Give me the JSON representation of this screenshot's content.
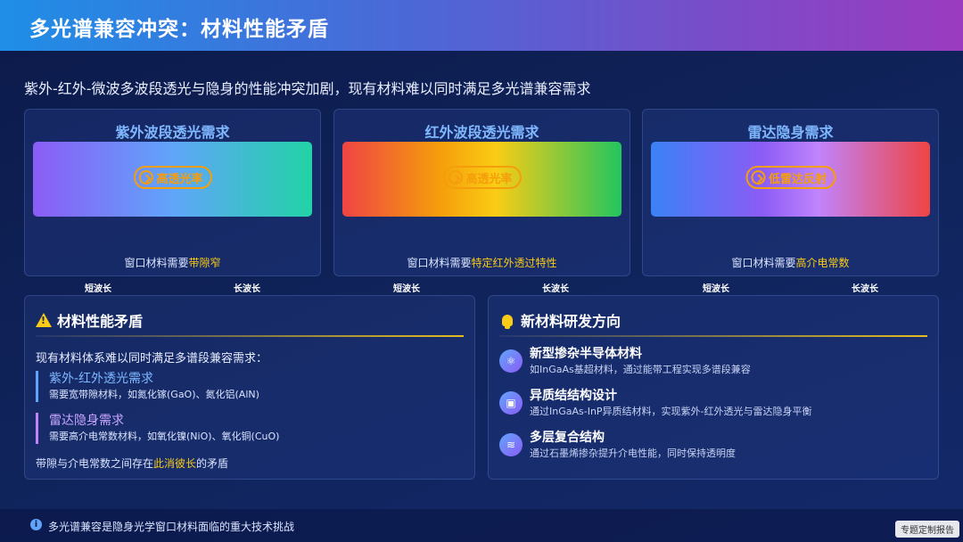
{
  "header": {
    "title": "多光谱兼容冲突：材料性能矛盾"
  },
  "subtitle": "紫外-红外-微波多波段透光与隐身的性能冲突加剧，现有材料难以同时满足多光谱兼容需求",
  "spectrum_cards": [
    {
      "title": "紫外波段透光需求",
      "badge": "高透光率",
      "note_prefix": "窗口材料需要",
      "note_highlight": "带隙窄",
      "short_label": "短波长",
      "long_label": "长波长"
    },
    {
      "title": "红外波段透光需求",
      "badge": "高透光率",
      "note_prefix": "窗口材料需要",
      "note_highlight": "特定红外透过特性",
      "short_label": "短波长",
      "long_label": "长波长"
    },
    {
      "title": "雷达隐身需求",
      "badge": "低雷达反射",
      "note_prefix": "窗口材料需要",
      "note_highlight": "高介电常数",
      "short_label": "短波长",
      "long_label": "长波长"
    }
  ],
  "conflict_panel": {
    "title": "材料性能矛盾",
    "icon": "warning-icon",
    "intro": "现有材料体系难以同时满足多谱段兼容需求：",
    "items": [
      {
        "title": "紫外-红外透光需求",
        "desc": "需要宽带隙材料，如氮化镓(GaO)、氮化铝(AlN)"
      },
      {
        "title": "雷达隐身需求",
        "desc": "需要高介电常数材料，如氧化镍(NiO)、氧化铜(CuO)"
      }
    ],
    "summary_prefix": "带隙与介电常数之间存在",
    "summary_highlight": "此消彼长",
    "summary_suffix": "的矛盾"
  },
  "direction_panel": {
    "title": "新材料研发方向",
    "icon": "lightbulb-icon",
    "items": [
      {
        "title": "新型掺杂半导体材料",
        "desc": "如InGaAs基超材料，通过能带工程实现多谱段兼容",
        "icon": "atom-icon",
        "glyph": "⚛"
      },
      {
        "title": "异质结结构设计",
        "desc": "通过InGaAs-InP异质结材料，实现紫外-红外透光与雷达隐身平衡",
        "icon": "chip-icon",
        "glyph": "▣"
      },
      {
        "title": "多层复合结构",
        "desc": "通过石墨烯掺杂提升介电性能，同时保持透明度",
        "icon": "layers-icon",
        "glyph": "≋"
      }
    ]
  },
  "footer": {
    "icon": "info-icon",
    "text": "多光谱兼容是隐身光学窗口材料面临的重大技术挑战",
    "watermark": "专题定制报告"
  },
  "colors": {
    "accent": "#7fb8ff",
    "highlight": "#facc15",
    "badge": "#f59e0b"
  }
}
